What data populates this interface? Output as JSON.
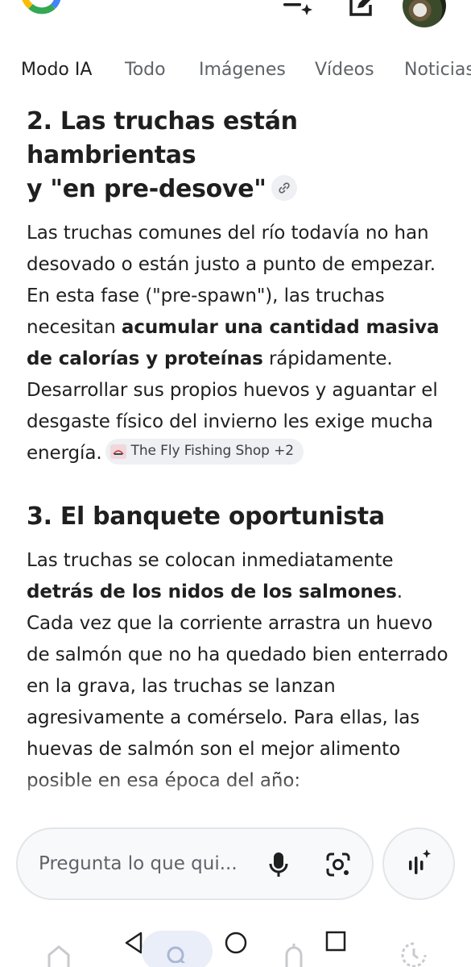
{
  "header": {
    "logo": "google-g-logo",
    "actions": [
      "labs-menu-icon",
      "edit-icon"
    ],
    "avatar": "profile-photo"
  },
  "tabs": [
    {
      "label": "Modo IA",
      "active": true
    },
    {
      "label": "Todo",
      "active": false
    },
    {
      "label": "Imágenes",
      "active": false
    },
    {
      "label": "Vídeos",
      "active": false
    },
    {
      "label": "Noticias",
      "active": false
    }
  ],
  "sections": [
    {
      "heading_line1": "2. Las truchas están hambrientas",
      "heading_line2": "y \"en pre-desove\"",
      "body": {
        "t1": "Las truchas comunes del río todavía no han desovado o están justo a punto de empezar. En esta fase (\"pre-spawn\"), las truchas necesitan ",
        "b1": "acumular una cantidad masiva de calorías y proteínas",
        "t2": " rápidamente. Desarrollar sus propios huevos y aguantar el desgaste físico del invierno les exige mucha energía."
      },
      "source": {
        "label": "The Fly Fishing Shop +2",
        "icon": "site-favicon"
      }
    },
    {
      "heading": "3. El banquete oportunista",
      "body": {
        "t1": "Las truchas se colocan inmediatamente ",
        "b1": "detrás de los nidos de los salmones",
        "t2": ". Cada vez que la corriente arrastra un huevo de salmón que no ha quedado bien enterrado en la grava, las truchas se lanzan agresivamente a comérselo. Para ellas, las huevas de salmón son el mejor alimento posible en esa época del año:"
      }
    }
  ],
  "search": {
    "placeholder": "Pregunta lo que qui..."
  },
  "colors": {
    "text": "#1f1f1f",
    "muted": "#5f6368",
    "chip_bg": "#eef0f3",
    "border": "#e3e5e8"
  }
}
